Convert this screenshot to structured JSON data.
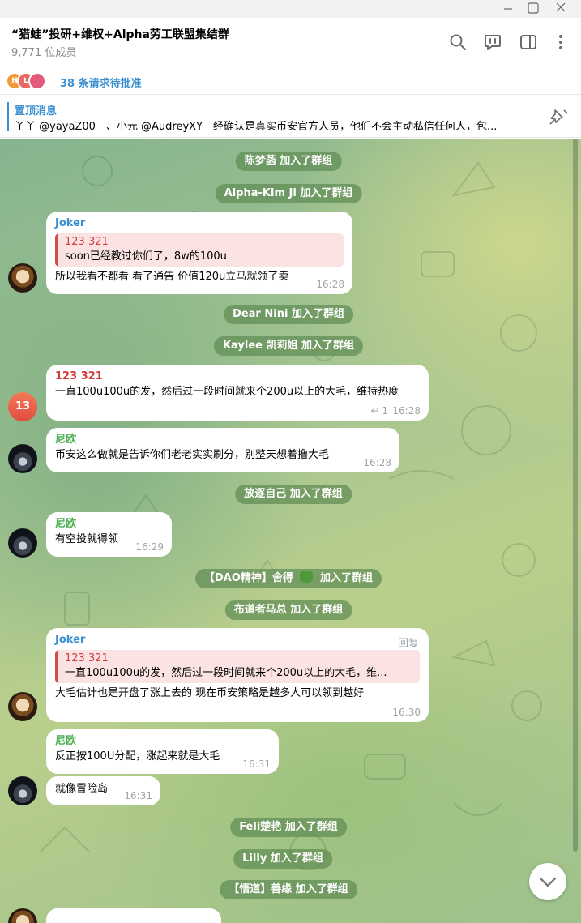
{
  "window": {
    "minimize": "minimize",
    "maximize": "maximize",
    "close": "close"
  },
  "header": {
    "title": "“猎蛙”投研+维权+Alpha劳工联盟集结群",
    "members": "9,771 位成员",
    "icons": [
      "search-icon",
      "voice-chat-icon",
      "side-panel-icon",
      "more-icon"
    ]
  },
  "requests": {
    "avatars": [
      {
        "letter": "H",
        "color": "#f29a3a"
      },
      {
        "letter": "L",
        "color": "#e8675f"
      },
      {
        "letter": "",
        "color": "#e45a7a"
      }
    ],
    "text": "38 条请求待批准"
  },
  "pinned": {
    "title": "置顶消息",
    "text": "丫丫 @yayaZ00　、小元 @AudreyXY　经确认是真实币安官方人员，他们不会主动私信任何人，包..."
  },
  "messages": {
    "sys1": "陈梦菡 加入了群组",
    "sys2": "Alpha-Kim Ji 加入了群组",
    "m1": {
      "sender": "Joker",
      "reply_name": "123 321",
      "reply_text": "soon已经教过你们了，8w的100u",
      "text": "所以我看不都看 看了通告 价值120u立马就领了卖",
      "time": "16:28"
    },
    "sys3": "Dear Nini 加入了群组",
    "sys4": "Kaylee 凯莉姐 加入了群组",
    "m2": {
      "sender": "123 321",
      "avatar": "13",
      "text": "一直100u100u的发，然后过一段时间就来个200u以上的大毛，维持热度",
      "reaction": "↩ 1",
      "time": "16:28"
    },
    "m3": {
      "sender": "尼欧",
      "text": "币安这么做就是告诉你们老老实实刷分，别整天想着撸大毛",
      "time": "16:28"
    },
    "sys5": "放逐自己 加入了群组",
    "m4": {
      "sender": "尼欧",
      "text": "有空投就得领",
      "time": "16:29"
    },
    "sys6": "【DAO精神】舍得",
    "sys6_suffix": "加入了群组",
    "sys7": "布道者马总 加入了群组",
    "m5": {
      "sender": "Joker",
      "reply_label": "回复",
      "reply_name": "123 321",
      "reply_text": "一直100u100u的发，然后过一段时间就来个200u以上的大毛，维...",
      "text": "大毛估计也是开盘了涨上去的 现在币安策略是越多人可以领到越好",
      "time": "16:30"
    },
    "m6": {
      "sender": "尼欧",
      "text": "反正按100U分配，涨起来就是大毛",
      "time": "16:31"
    },
    "m7": {
      "text": "就像冒险岛",
      "time": "16:31"
    },
    "sys8": "Feli楚艳 加入了群组",
    "sys9": "Lilly 加入了群组",
    "sys10": "【悟道】善缘 加入了群组"
  },
  "colors": {
    "accent": "#3a8fd1",
    "joker_name": "#3a8fd1",
    "niou_name": "#4caf50",
    "reply_name": "#d43b3b"
  }
}
